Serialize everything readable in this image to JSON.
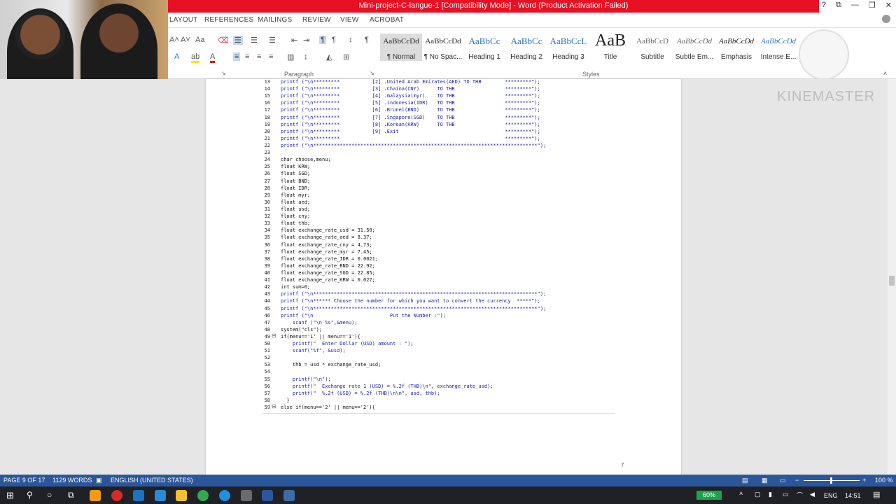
{
  "window": {
    "title": "Mini-project-C-langue-1 [Compatibility Mode] - Word (Product Activation Failed)",
    "help": "?",
    "minimize": "—",
    "restore": "❐",
    "close": "✕"
  },
  "tabs": [
    "LAYOUT",
    "REFERENCES",
    "MAILINGS",
    "REVIEW",
    "VIEW",
    "ACROBAT"
  ],
  "ribbon": {
    "paragraph_label": "Paragraph",
    "styles_label": "Styles",
    "styles": [
      {
        "sample": "AaBbCcDd",
        "name": "¶ Normal"
      },
      {
        "sample": "AaBbCcDd",
        "name": "¶ No Spac..."
      },
      {
        "sample": "AaBbCc",
        "name": "Heading 1"
      },
      {
        "sample": "AaBbCc",
        "name": "Heading 2"
      },
      {
        "sample": "AaBbCcL",
        "name": "Heading 3"
      },
      {
        "sample": "AaB",
        "name": "Title"
      },
      {
        "sample": "AaBbCcD",
        "name": "Subtitle"
      },
      {
        "sample": "AaBbCcDd",
        "name": "Subtle Em..."
      },
      {
        "sample": "AaBbCcDd",
        "name": "Emphasis"
      },
      {
        "sample": "AaBbCcDd",
        "name": "Intense E..."
      }
    ]
  },
  "watermark": "KINEMASTER",
  "code_lines": [
    {
      "n": "13",
      "t": "printf (\"\\n*********           [2] .United Arab Emirates(AED) TO THB        *********\");"
    },
    {
      "n": "14",
      "t": "printf (\"\\n*********           [3] .Chaina(CNY)      TO THB                 *********\");"
    },
    {
      "n": "15",
      "t": "printf (\"\\n*********           [4] .malaysia(myr)    TO THB                 *********\");"
    },
    {
      "n": "16",
      "t": "printf (\"\\n*********           [5] .indonesia(IDR)   TO THB                 *********\");"
    },
    {
      "n": "17",
      "t": "printf (\"\\n*********           [6] .Brunei(BND)      TO THB                 *********\");"
    },
    {
      "n": "18",
      "t": "printf (\"\\n*********           [7] .Sngapore(SGD)    TO THB                 *********\");"
    },
    {
      "n": "19",
      "t": "printf (\"\\n*********           [8] .Korean(KRW)      TO THB                 *********\");"
    },
    {
      "n": "20",
      "t": "printf (\"\\n*********           [9] .Exit                                    *********\");"
    },
    {
      "n": "21",
      "t": "printf (\"\\n*********                                                        *********\");"
    },
    {
      "n": "22",
      "t": "printf (\"\\n****************************************************************************\");"
    },
    {
      "n": "23",
      "t": ""
    },
    {
      "n": "24",
      "t": "char choose,menu;"
    },
    {
      "n": "25",
      "t": "float KRW;"
    },
    {
      "n": "26",
      "t": "float SGD;"
    },
    {
      "n": "27",
      "t": "float BND;"
    },
    {
      "n": "28",
      "t": "float IDR;"
    },
    {
      "n": "29",
      "t": "float myr;"
    },
    {
      "n": "30",
      "t": "float aed;"
    },
    {
      "n": "31",
      "t": "float usd;"
    },
    {
      "n": "32",
      "t": "float cny;"
    },
    {
      "n": "33",
      "t": "float thb;"
    },
    {
      "n": "34",
      "t": "float exchange_rate_usd = 31.50;"
    },
    {
      "n": "35",
      "t": "float exchange_rate_aed = 8.37;"
    },
    {
      "n": "36",
      "t": "float exchange_rate_cny = 4.73;"
    },
    {
      "n": "37",
      "t": "float exchange_rate_myr = 7.45;"
    },
    {
      "n": "38",
      "t": "float exchange_rate_IDR = 0.0021;"
    },
    {
      "n": "39",
      "t": "float exchange_rate_BND = 22.92;"
    },
    {
      "n": "40",
      "t": "float exchange_rate_SGD = 22.85;"
    },
    {
      "n": "41",
      "t": "float exchange_rate_KRW = 0.027;"
    },
    {
      "n": "42",
      "t": "int sum=0;"
    },
    {
      "n": "43",
      "t": "printf (\"\\n****************************************************************************\");"
    },
    {
      "n": "44",
      "t": "printf (\"\\n****** Choose the number for which you want to convert the currency  *****\");"
    },
    {
      "n": "45",
      "t": "printf (\"\\n****************************************************************************\");"
    },
    {
      "n": "46",
      "t": "printf (\"\\n                          Put the Number :\");"
    },
    {
      "n": "47",
      "t": "    scanf (\"\\n %s\",&menu);"
    },
    {
      "n": "48",
      "t": "system(\"cls\");"
    },
    {
      "n": "49",
      "t": "if(menu=='1' || menu=='1'){"
    },
    {
      "n": "50",
      "t": "    printf(\"  Enter Dollar (USD) amount : \");"
    },
    {
      "n": "51",
      "t": "    scanf(\"%f\", &usd);"
    },
    {
      "n": "52",
      "t": ""
    },
    {
      "n": "53",
      "t": "    thb = usd * exchange_rate_usd;"
    },
    {
      "n": "54",
      "t": ""
    },
    {
      "n": "55",
      "t": "    printf(\"\\n\");"
    },
    {
      "n": "56",
      "t": "    printf(\"  Exchange rate 1 (USD) = %.2f (THB)\\n\", exchange_rate_usd);"
    },
    {
      "n": "57",
      "t": "    printf(\"  %.2f (USD) = %.2f (THB)\\n\\n\", usd, thb);"
    },
    {
      "n": "58",
      "t": "  }"
    },
    {
      "n": "59",
      "t": "else if(menu=='2' || menu=='2'){"
    }
  ],
  "page_number": "7",
  "status": {
    "page": "PAGE 9 OF 17",
    "words": "1129 WORDS",
    "language": "ENGLISH (UNITED STATES)",
    "zoom": "100 %"
  },
  "taskbar": {
    "battery": "60%",
    "lang": "ENG",
    "time": "14:51"
  }
}
